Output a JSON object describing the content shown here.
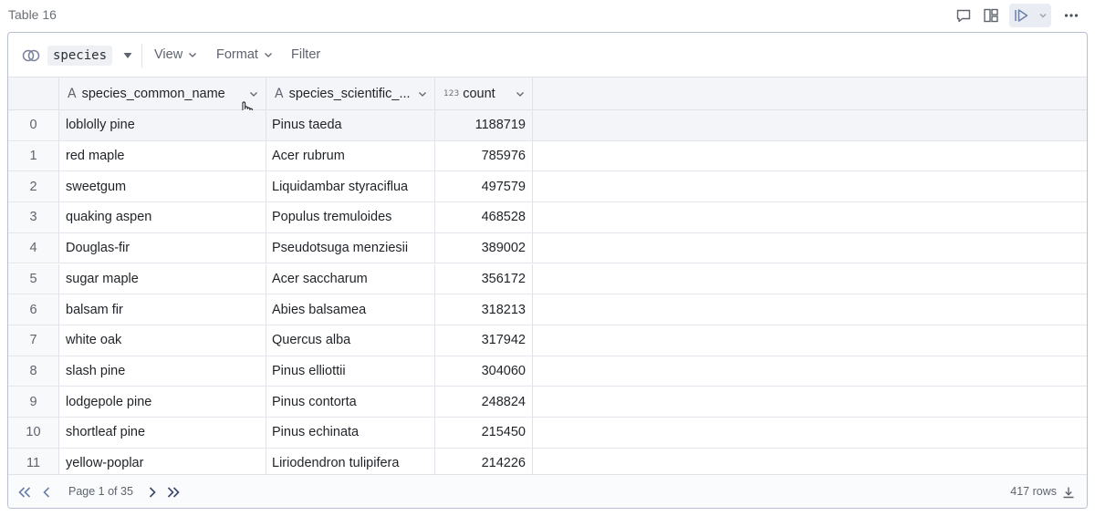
{
  "cell": {
    "title": "Table 16",
    "actions": [
      "comment-icon",
      "layout-icon",
      "run-icon",
      "chevron-down-icon",
      "more-icon"
    ]
  },
  "toolbar": {
    "source_icon": "link-icon",
    "source_name": "species",
    "menus": [
      "View",
      "Format",
      "Filter"
    ]
  },
  "columns": [
    {
      "type_icon": "A",
      "name": "species_common_name"
    },
    {
      "type_icon": "A",
      "name": "species_scientific_..."
    },
    {
      "type_icon": "123",
      "name": "count"
    }
  ],
  "rows": [
    {
      "idx": "0",
      "common": "loblolly pine",
      "scientific": "Pinus taeda",
      "count": "1188719"
    },
    {
      "idx": "1",
      "common": "red maple",
      "scientific": "Acer rubrum",
      "count": "785976"
    },
    {
      "idx": "2",
      "common": "sweetgum",
      "scientific": "Liquidambar styraciflua",
      "count": "497579"
    },
    {
      "idx": "3",
      "common": "quaking aspen",
      "scientific": "Populus tremuloides",
      "count": "468528"
    },
    {
      "idx": "4",
      "common": "Douglas-fir",
      "scientific": "Pseudotsuga menziesii",
      "count": "389002"
    },
    {
      "idx": "5",
      "common": "sugar maple",
      "scientific": "Acer saccharum",
      "count": "356172"
    },
    {
      "idx": "6",
      "common": "balsam fir",
      "scientific": "Abies balsamea",
      "count": "318213"
    },
    {
      "idx": "7",
      "common": "white oak",
      "scientific": "Quercus alba",
      "count": "317942"
    },
    {
      "idx": "8",
      "common": "slash pine",
      "scientific": "Pinus elliottii",
      "count": "304060"
    },
    {
      "idx": "9",
      "common": "lodgepole pine",
      "scientific": "Pinus contorta",
      "count": "248824"
    },
    {
      "idx": "10",
      "common": "shortleaf pine",
      "scientific": "Pinus echinata",
      "count": "215450"
    },
    {
      "idx": "11",
      "common": "yellow-poplar",
      "scientific": "Liriodendron tulipifera",
      "count": "214226"
    }
  ],
  "footer": {
    "page_text": "Page 1 of 35",
    "rows_text": "417 rows"
  },
  "colors": {
    "panel_border": "#b9bfd3",
    "header_bg": "#f4f5f8",
    "muted_text": "#5e636d",
    "run_group_bg": "#e9ecf2"
  }
}
